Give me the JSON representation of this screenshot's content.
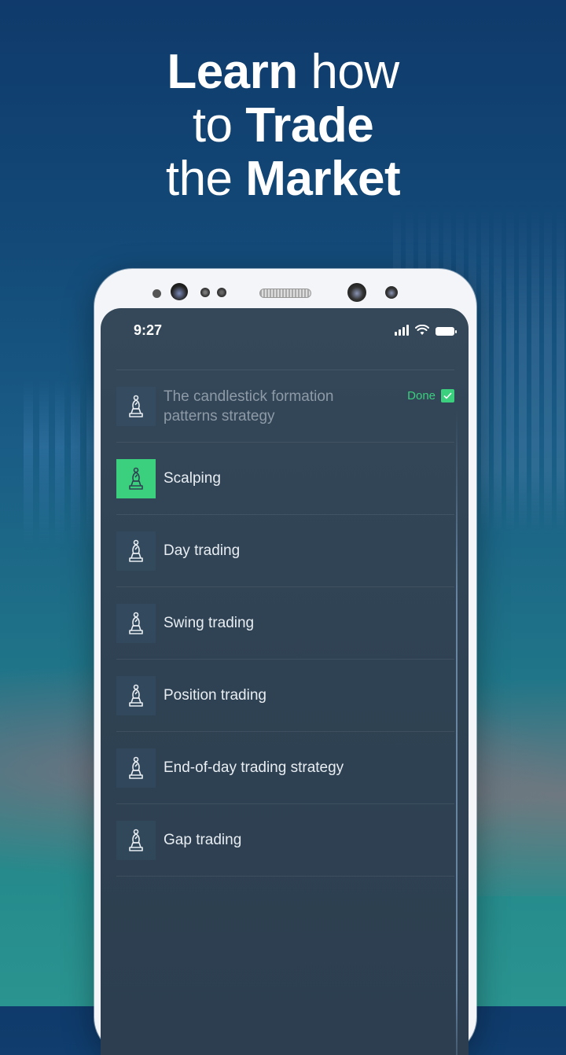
{
  "headline": {
    "line1_bold": "Learn",
    "line1_light": "how",
    "line2_light": "to",
    "line2_bold": "Trade",
    "line3_light": "the",
    "line3_bold": "Market"
  },
  "status_bar": {
    "time": "9:27",
    "icons": [
      "signal-icon",
      "wifi-icon",
      "battery-icon"
    ]
  },
  "colors": {
    "accent_green": "#3ad07d",
    "screen_bg": "#2f4253",
    "background_top": "#0f3a6b",
    "background_bottom": "#2a9490"
  },
  "strategies": [
    {
      "label": "The candlestick formation patterns strategy",
      "icon": "chess-pawn-icon",
      "status": "done",
      "status_label": "Done"
    },
    {
      "label": "Scalping",
      "icon": "chess-pawn-icon",
      "status": "active"
    },
    {
      "label": "Day trading",
      "icon": "chess-pawn-icon",
      "status": ""
    },
    {
      "label": "Swing trading",
      "icon": "chess-pawn-icon",
      "status": ""
    },
    {
      "label": "Position trading",
      "icon": "chess-pawn-icon",
      "status": ""
    },
    {
      "label": "End-of-day trading strategy",
      "icon": "chess-pawn-icon",
      "status": ""
    },
    {
      "label": "Gap trading",
      "icon": "chess-pawn-icon",
      "status": ""
    }
  ]
}
